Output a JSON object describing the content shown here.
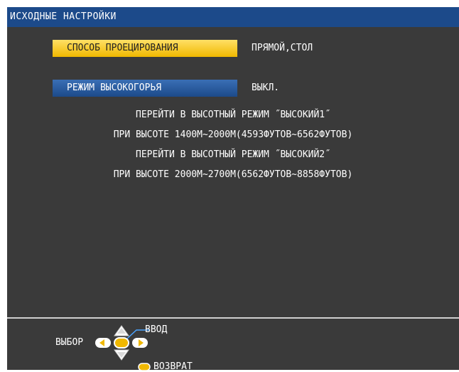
{
  "header": {
    "title": "ИСХОДНЫЕ НАСТРОЙКИ"
  },
  "menu": {
    "items": [
      {
        "label": "СПОСОБ ПРОЕЦИРОВАНИЯ",
        "value": "ПРЯМОЙ,СТОЛ"
      },
      {
        "label": "РЕЖИМ ВЫСОКОГОРЬЯ",
        "value": "ВЫКЛ."
      }
    ]
  },
  "info": {
    "lines": [
      "ПЕРЕЙТИ В ВЫСОТНЫЙ РЕЖИМ ˝ВЫСОКИЙ1˝",
      "ПРИ ВЫСОТЕ 1400М~2000М(4593ФУТОВ~6562ФУТОВ)",
      "ПЕРЕЙТИ В ВЫСОТНЫЙ РЕЖИМ ˝ВЫСОКИЙ2˝",
      "ПРИ ВЫСОТЕ 2000М~2700М(6562ФУТОВ~8858ФУТОВ)"
    ]
  },
  "footer": {
    "select_label": "ВЫБОР",
    "enter_label": "ВВОД",
    "return_label": "ВОЗВРАТ"
  },
  "colors": {
    "titlebar": "#1c4a8a",
    "panel": "#3a3a3a",
    "highlight_yellow": "#f0b800",
    "highlight_blue": "#1c4a8a"
  }
}
